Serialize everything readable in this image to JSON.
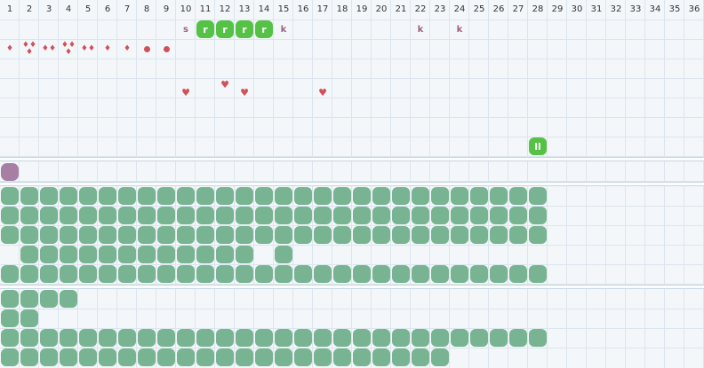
{
  "columns": [
    "1",
    "2",
    "3",
    "4",
    "5",
    "6",
    "7",
    "8",
    "9",
    "10",
    "11",
    "12",
    "13",
    "14",
    "15",
    "16",
    "17",
    "18",
    "19",
    "20",
    "21",
    "22",
    "23",
    "24",
    "25",
    "26",
    "27",
    "28",
    "29",
    "30",
    "31",
    "32",
    "33",
    "34",
    "35",
    "36"
  ],
  "colors": {
    "green_blob": "#78b392",
    "green_stamp": "#55c245",
    "purple_blob": "#a77ea4",
    "red": "#d2505a",
    "label": "#a0607e"
  },
  "track1": {
    "labels": [
      {
        "col": 10,
        "text": "s"
      },
      {
        "col": 15,
        "text": "k"
      },
      {
        "col": 22,
        "text": "k"
      },
      {
        "col": 24,
        "text": "k"
      }
    ],
    "stamps": [
      {
        "col": 11,
        "text": "r"
      },
      {
        "col": 12,
        "text": "r"
      },
      {
        "col": 13,
        "text": "r"
      },
      {
        "col": 14,
        "text": "r"
      }
    ],
    "drops": [
      {
        "col": 1,
        "count": 1,
        "icon": "drop-icon"
      },
      {
        "col": 2,
        "count": 3,
        "icon": "drop-icon"
      },
      {
        "col": 3,
        "count": 2,
        "icon": "drop-icon"
      },
      {
        "col": 4,
        "count": 3,
        "icon": "drop-icon"
      },
      {
        "col": 5,
        "count": 2,
        "icon": "drop-icon"
      },
      {
        "col": 6,
        "count": 1,
        "icon": "drop-icon"
      },
      {
        "col": 7,
        "count": 1,
        "icon": "drop-icon"
      }
    ],
    "dots": [
      8,
      9
    ],
    "hearts_row4": [
      10,
      13,
      17
    ],
    "hearts_row4_up": [
      12
    ],
    "stamp_row7": [
      {
        "col": 28,
        "text": "ll"
      }
    ]
  },
  "track2": {
    "purple_cols": [
      1
    ]
  },
  "track3": {
    "rows": [
      {
        "from": 1,
        "to": 28
      },
      {
        "from": 1,
        "to": 28
      },
      {
        "from": 1,
        "to": 28
      },
      {
        "cols": [
          2,
          3,
          4,
          5,
          6,
          7,
          8,
          9,
          10,
          11,
          12,
          13,
          15
        ]
      },
      {
        "from": 1,
        "to": 28
      }
    ]
  },
  "track4": {
    "rows": [
      {
        "from": 1,
        "to": 4
      },
      {
        "from": 1,
        "to": 2
      },
      {
        "from": 1,
        "to": 28
      },
      {
        "from": 1,
        "to": 23
      }
    ]
  }
}
